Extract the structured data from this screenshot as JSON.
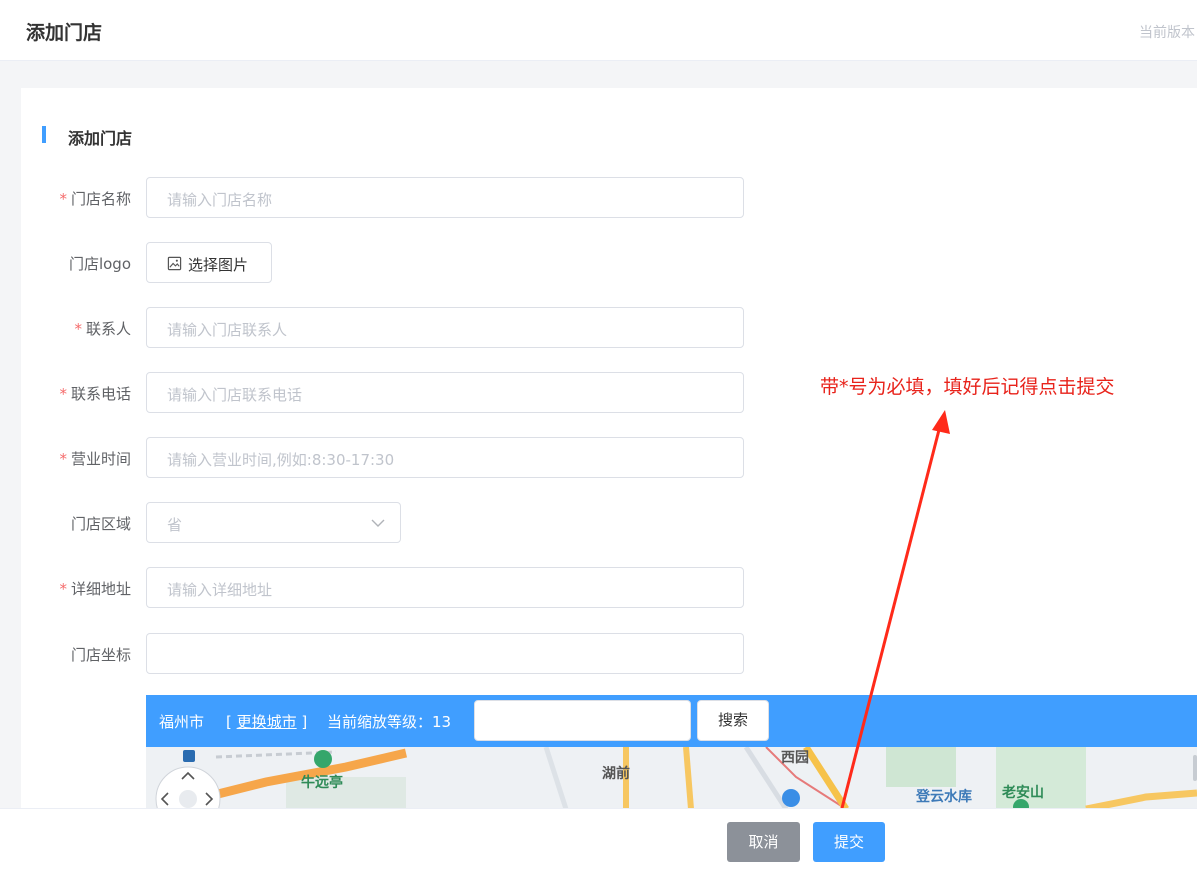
{
  "header": {
    "title": "添加门店",
    "version_text": "当前版本"
  },
  "section": {
    "title": "添加门店"
  },
  "form": {
    "name": {
      "label": "门店名称",
      "required": "*",
      "placeholder": "请输入门店名称"
    },
    "logo": {
      "label": "门店logo",
      "button": "选择图片"
    },
    "contact": {
      "label": "联系人",
      "required": "*",
      "placeholder": "请输入门店联系人"
    },
    "phone": {
      "label": "联系电话",
      "required": "*",
      "placeholder": "请输入门店联系电话"
    },
    "hours": {
      "label": "营业时间",
      "required": "*",
      "placeholder": "请输入营业时间,例如:8:30-17:30"
    },
    "region": {
      "label": "门店区域",
      "placeholder": "省"
    },
    "address": {
      "label": "详细地址",
      "required": "*",
      "placeholder": "请输入详细地址"
    },
    "coords": {
      "label": "门店坐标",
      "value": ""
    }
  },
  "map": {
    "city": "福州市",
    "change_city_open": "[ ",
    "change_city": "更换城市",
    "change_city_close": " ]",
    "zoom_text": "当前缩放等级：13",
    "search_button": "搜索",
    "places": [
      "湖前",
      "西园",
      "牛远亭",
      "登云水库",
      "老安山"
    ]
  },
  "annotation": {
    "text": "带*号为必填，填好后记得点击提交",
    "color": "#e8231b"
  },
  "footer": {
    "cancel": "取消",
    "submit": "提交"
  },
  "colors": {
    "accent": "#409eff",
    "required": "#f56c6c",
    "cancel_bg": "#8c9199"
  }
}
